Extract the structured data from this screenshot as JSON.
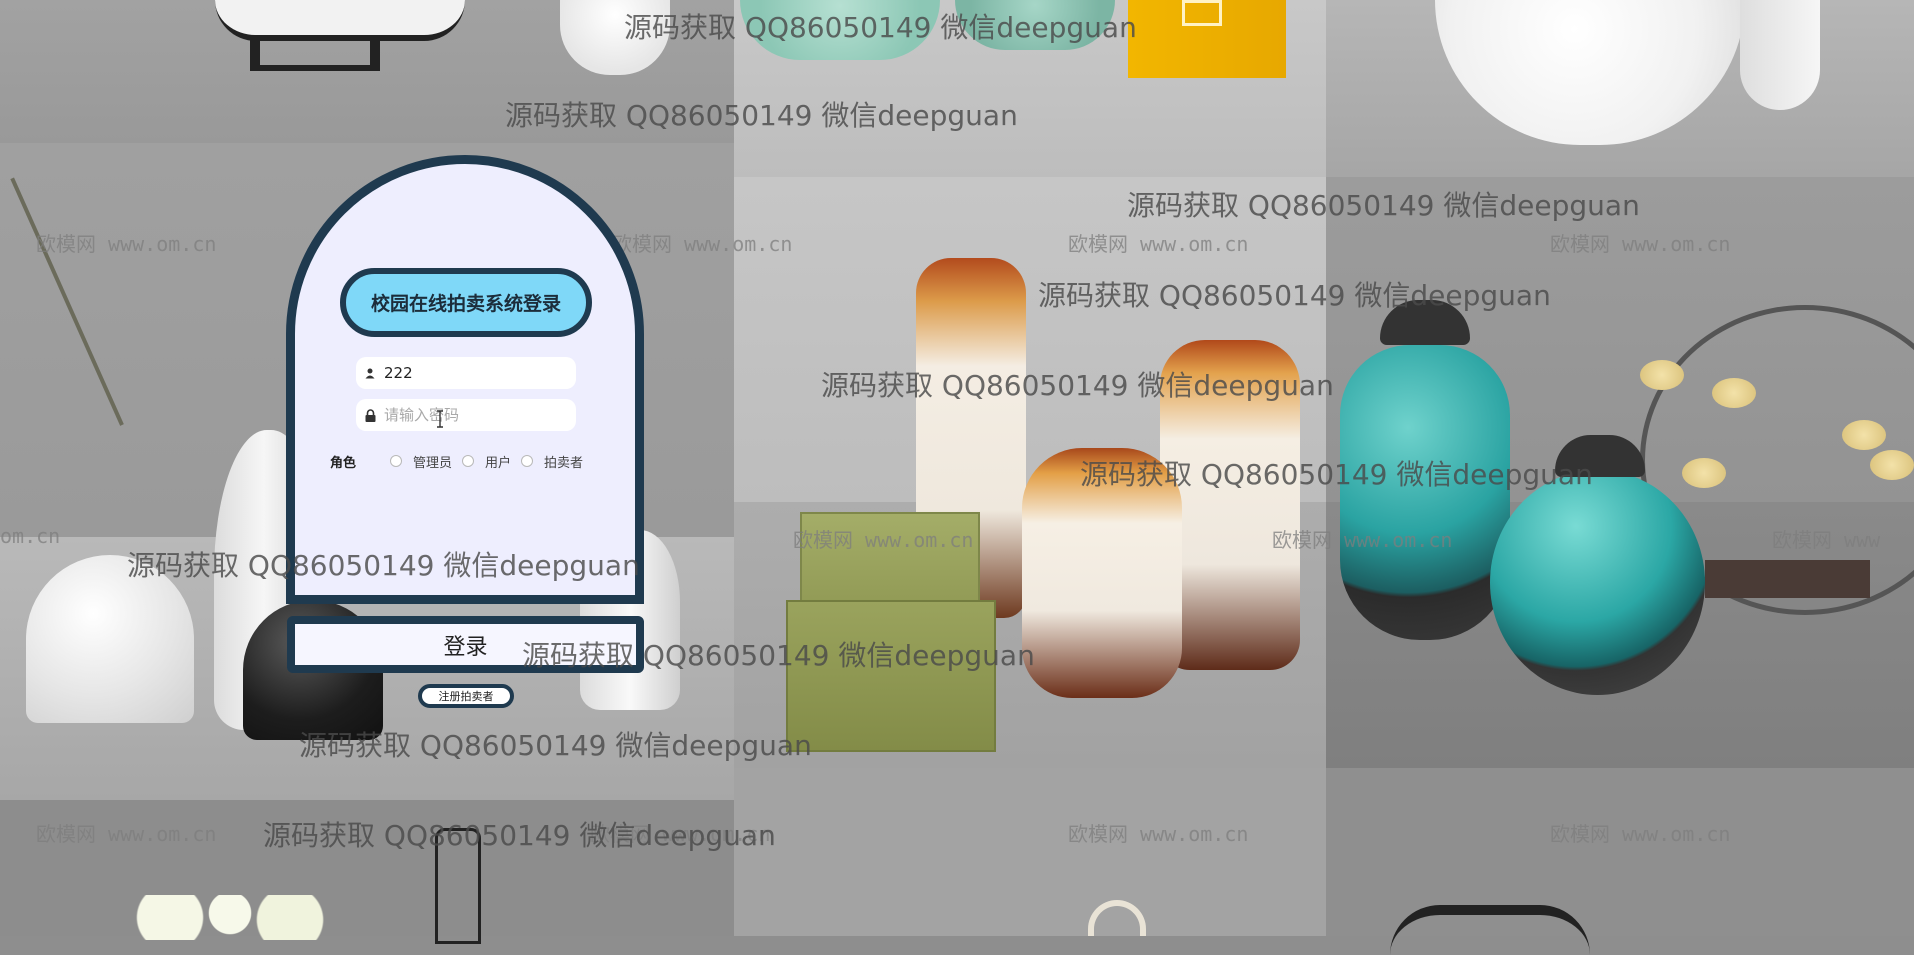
{
  "login": {
    "title": "校园在线拍卖系统登录",
    "username": {
      "value": "222",
      "icon": "user-icon"
    },
    "password": {
      "placeholder": "请输入密码",
      "icon": "lock-icon"
    },
    "role_label": "角色",
    "roles": [
      "管理员",
      "用户",
      "拍卖者"
    ],
    "login_button": "登录",
    "register_button": "注册拍卖者"
  },
  "watermarks": {
    "qq": "源码获取 QQ86050149 微信deepguan",
    "site": "欧模网 www.om.cn",
    "site_partial_left": "om.cn",
    "site_partial_right": "欧模网 www"
  },
  "colors": {
    "card_bg": "#eeeefe",
    "card_border": "#1f3a4f",
    "title_bg": "#7fd8f8"
  }
}
